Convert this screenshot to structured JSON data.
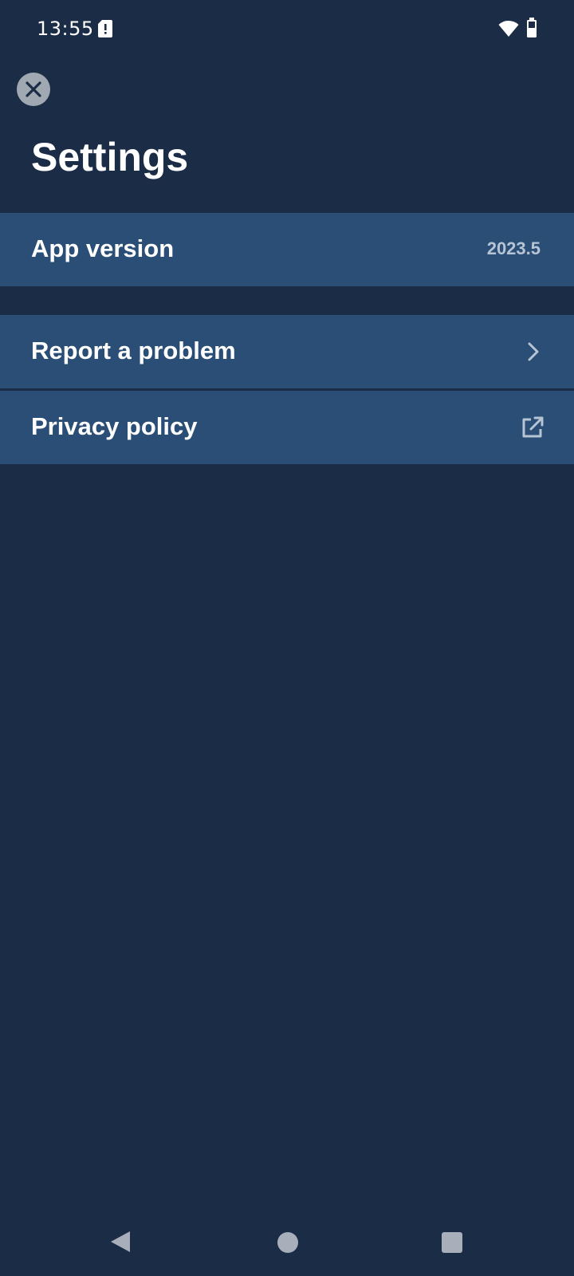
{
  "status_bar": {
    "time": "13:55",
    "icons": [
      "sim-alert-icon",
      "wifi-icon",
      "battery-icon"
    ]
  },
  "header": {
    "close_icon": "close-icon",
    "title": "Settings"
  },
  "settings": {
    "app_version": {
      "label": "App version",
      "value": "2023.5"
    },
    "items": [
      {
        "label": "Report a problem",
        "icon": "chevron-right-icon"
      },
      {
        "label": "Privacy policy",
        "icon": "external-link-icon"
      }
    ]
  },
  "nav_bar": {
    "icons": [
      "back-icon",
      "home-icon",
      "recents-icon"
    ]
  },
  "colors": {
    "background": "#1b2d46",
    "row_background": "#2a4e76",
    "row_divider": "#1b2d46",
    "secondary_text": "#b7c4d4",
    "icon_gray": "#a8afba"
  }
}
